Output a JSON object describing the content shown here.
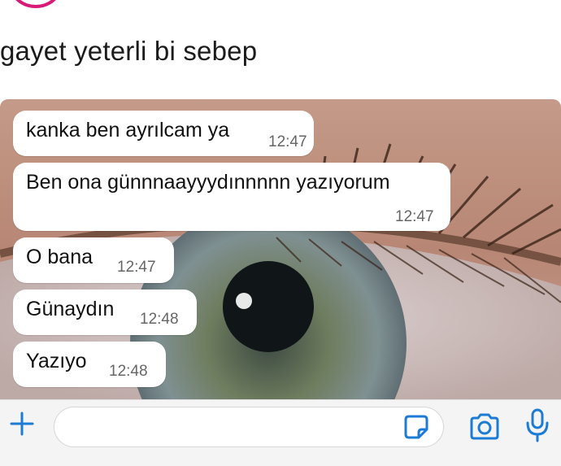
{
  "post": {
    "caption": "gayet yeterli bi sebep"
  },
  "chat": {
    "messages": [
      {
        "text": "kanka ben ayrılcam ya",
        "time": "12:47"
      },
      {
        "text": "Ben ona günnnaayyydınnnnn yazıyorum",
        "time": "12:47"
      },
      {
        "text": "O bana",
        "time": "12:47"
      },
      {
        "text": "Günaydın",
        "time": "12:48"
      },
      {
        "text": "Yazıyo",
        "time": "12:48"
      }
    ]
  },
  "composer": {
    "placeholder": "",
    "icons": [
      "plus-icon",
      "sticker-icon",
      "camera-icon",
      "mic-icon"
    ],
    "accent_color": "#1c7cd5"
  },
  "colors": {
    "avatar_ring": "#d81b7a",
    "bubble": "#ffffff"
  }
}
